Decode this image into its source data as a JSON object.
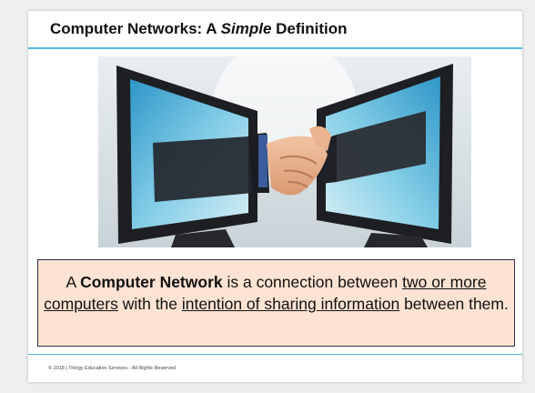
{
  "slide": {
    "title_before": "Computer Networks: A ",
    "title_emph": "Simple",
    "title_after": " Definition",
    "image_alt": "Two computer monitors with hands reaching out of the screens for a handshake",
    "callout": {
      "part1": "A ",
      "bold": "Computer Network",
      "part2": " is a connection between ",
      "link1": "two or more computers",
      "part3": " with the ",
      "link2": "intention of sharing information",
      "part4": " between them."
    },
    "footer": "© 2018 | Trilogy Education Services - All Rights Reserved"
  },
  "colors": {
    "accent_rule": "#55b9e0",
    "callout_bg": "#fde3d3",
    "callout_border": "#2b2f4a"
  },
  "icons": [
    "handshake-monitors-image"
  ]
}
